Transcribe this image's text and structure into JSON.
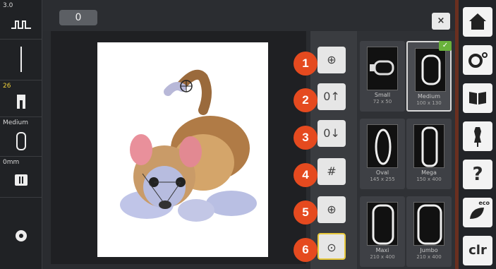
{
  "left_bar": {
    "tension_value": "3.0",
    "presser_foot_number": "26",
    "hoop_label": "Medium",
    "stitch_width": "0mm"
  },
  "top_bar": {
    "hoop_tab_symbol": "0",
    "close_symbol": "×"
  },
  "buttons": [
    {
      "number": "1",
      "icon": "center-hoop-icon",
      "symbol": "⊕"
    },
    {
      "number": "2",
      "icon": "hoop-move-up-icon",
      "symbol": "0↑"
    },
    {
      "number": "3",
      "icon": "hoop-move-down-icon",
      "symbol": "0↓"
    },
    {
      "number": "4",
      "icon": "grid-icon",
      "symbol": "#"
    },
    {
      "number": "5",
      "icon": "crosshair-icon",
      "symbol": "⊕"
    },
    {
      "number": "6",
      "icon": "centre-view-icon",
      "symbol": "⊙"
    }
  ],
  "hoops": [
    {
      "name": "Small",
      "size": "72 x 50"
    },
    {
      "name": "Medium",
      "size": "100 x 130"
    },
    {
      "name": "Oval",
      "size": "145 x 255"
    },
    {
      "name": "Mega",
      "size": "150 x 400"
    },
    {
      "name": "Maxi",
      "size": "210 x 400"
    },
    {
      "name": "Jumbo",
      "size": "210 x 400"
    }
  ],
  "right_bar": {
    "home_icon": "home-icon",
    "settings_icon": "settings-icon",
    "guide_icon": "book-icon",
    "creative_icon": "dress-form-icon",
    "help_label": "?",
    "eco_label": "eco",
    "clr_label": "clr"
  }
}
